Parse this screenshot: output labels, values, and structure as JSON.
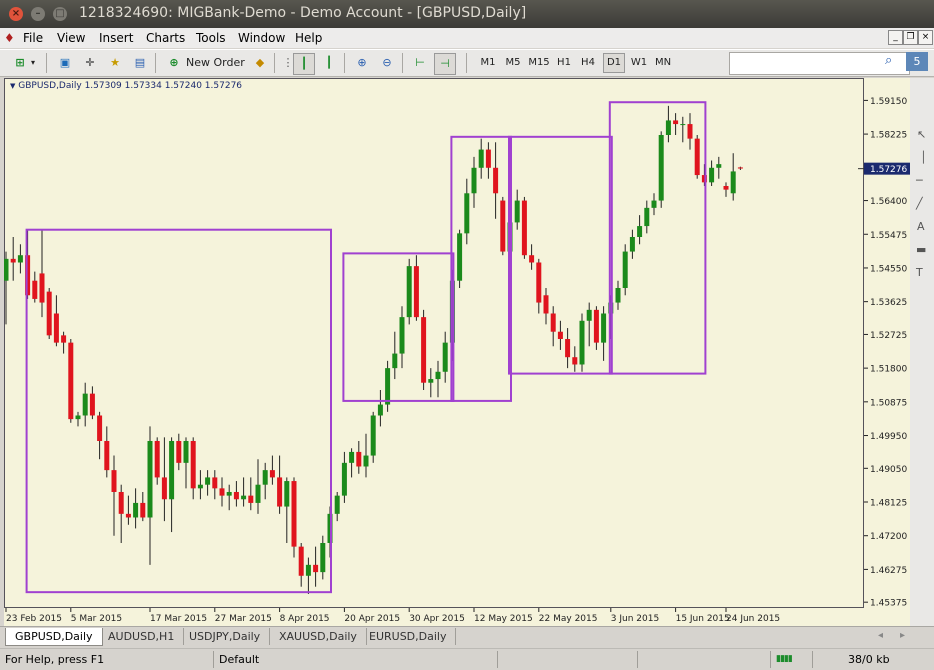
{
  "window": {
    "title": "1218324690: MIGBank-Demo - Demo Account - [GBPUSD,Daily]"
  },
  "menu": [
    "File",
    "View",
    "Insert",
    "Charts",
    "Tools",
    "Window",
    "Help"
  ],
  "toolbar": {
    "new_order_label": "New Order",
    "timeframes": [
      "M1",
      "M5",
      "M15",
      "H1",
      "H4",
      "D1",
      "W1",
      "MN"
    ],
    "active_timeframe": "D1",
    "search_value": "",
    "badge_count": "5"
  },
  "chart": {
    "header": "GBPUSD,Daily  1.57309 1.57334 1.57240 1.57276",
    "current_price": "1.57276",
    "price_ticks": [
      "1.59150",
      "1.58225",
      "1.57276",
      "1.56400",
      "1.55475",
      "1.54550",
      "1.53625",
      "1.52725",
      "1.51800",
      "1.50875",
      "1.49950",
      "1.49050",
      "1.48125",
      "1.47200",
      "1.46275",
      "1.45375"
    ],
    "date_ticks": [
      "23 Feb 2015",
      "5 Mar 2015",
      "17 Mar 2015",
      "27 Mar 2015",
      "8 Apr 2015",
      "20 Apr 2015",
      "30 Apr 2015",
      "12 May 2015",
      "22 May 2015",
      "3 Jun 2015",
      "15 Jun 2015",
      "24 Jun 2015"
    ],
    "colors": {
      "bull": "#1b8a1b",
      "bear": "#e0141e",
      "box": "#a040d0",
      "background": "#f5f3db"
    }
  },
  "chart_data": {
    "type": "candlestick",
    "symbol": "GBPUSD",
    "timeframe": "Daily",
    "ylim": [
      1.4538,
      1.596
    ],
    "candles": [
      {
        "o": 1.542,
        "h": 1.55,
        "l": 1.53,
        "c": 1.548
      },
      {
        "o": 1.548,
        "h": 1.554,
        "l": 1.542,
        "c": 1.547
      },
      {
        "o": 1.547,
        "h": 1.552,
        "l": 1.544,
        "c": 1.549
      },
      {
        "o": 1.549,
        "h": 1.556,
        "l": 1.537,
        "c": 1.538
      },
      {
        "o": 1.542,
        "h": 1.5445,
        "l": 1.536,
        "c": 1.537
      },
      {
        "o": 1.544,
        "h": 1.556,
        "l": 1.532,
        "c": 1.536
      },
      {
        "o": 1.539,
        "h": 1.54,
        "l": 1.526,
        "c": 1.527
      },
      {
        "o": 1.533,
        "h": 1.538,
        "l": 1.524,
        "c": 1.525
      },
      {
        "o": 1.527,
        "h": 1.528,
        "l": 1.522,
        "c": 1.525
      },
      {
        "o": 1.525,
        "h": 1.526,
        "l": 1.503,
        "c": 1.504
      },
      {
        "o": 1.504,
        "h": 1.506,
        "l": 1.502,
        "c": 1.505
      },
      {
        "o": 1.505,
        "h": 1.514,
        "l": 1.502,
        "c": 1.511
      },
      {
        "o": 1.511,
        "h": 1.513,
        "l": 1.504,
        "c": 1.505
      },
      {
        "o": 1.505,
        "h": 1.506,
        "l": 1.493,
        "c": 1.498
      },
      {
        "o": 1.498,
        "h": 1.502,
        "l": 1.488,
        "c": 1.49
      },
      {
        "o": 1.49,
        "h": 1.494,
        "l": 1.472,
        "c": 1.484
      },
      {
        "o": 1.484,
        "h": 1.486,
        "l": 1.47,
        "c": 1.478
      },
      {
        "o": 1.478,
        "h": 1.483,
        "l": 1.475,
        "c": 1.477
      },
      {
        "o": 1.477,
        "h": 1.485,
        "l": 1.474,
        "c": 1.481
      },
      {
        "o": 1.481,
        "h": 1.484,
        "l": 1.476,
        "c": 1.477
      },
      {
        "o": 1.477,
        "h": 1.502,
        "l": 1.464,
        "c": 1.498
      },
      {
        "o": 1.498,
        "h": 1.499,
        "l": 1.486,
        "c": 1.488
      },
      {
        "o": 1.488,
        "h": 1.499,
        "l": 1.476,
        "c": 1.482
      },
      {
        "o": 1.482,
        "h": 1.499,
        "l": 1.473,
        "c": 1.498
      },
      {
        "o": 1.498,
        "h": 1.5,
        "l": 1.49,
        "c": 1.492
      },
      {
        "o": 1.492,
        "h": 1.499,
        "l": 1.485,
        "c": 1.498
      },
      {
        "o": 1.498,
        "h": 1.499,
        "l": 1.482,
        "c": 1.485
      },
      {
        "o": 1.485,
        "h": 1.49,
        "l": 1.482,
        "c": 1.486
      },
      {
        "o": 1.486,
        "h": 1.49,
        "l": 1.483,
        "c": 1.488
      },
      {
        "o": 1.488,
        "h": 1.49,
        "l": 1.482,
        "c": 1.485
      },
      {
        "o": 1.485,
        "h": 1.488,
        "l": 1.48,
        "c": 1.483
      },
      {
        "o": 1.483,
        "h": 1.486,
        "l": 1.479,
        "c": 1.484
      },
      {
        "o": 1.484,
        "h": 1.487,
        "l": 1.48,
        "c": 1.482
      },
      {
        "o": 1.482,
        "h": 1.488,
        "l": 1.48,
        "c": 1.483
      },
      {
        "o": 1.483,
        "h": 1.488,
        "l": 1.479,
        "c": 1.481
      },
      {
        "o": 1.481,
        "h": 1.493,
        "l": 1.478,
        "c": 1.486
      },
      {
        "o": 1.486,
        "h": 1.492,
        "l": 1.482,
        "c": 1.49
      },
      {
        "o": 1.49,
        "h": 1.494,
        "l": 1.486,
        "c": 1.488
      },
      {
        "o": 1.488,
        "h": 1.494,
        "l": 1.478,
        "c": 1.48
      },
      {
        "o": 1.48,
        "h": 1.488,
        "l": 1.47,
        "c": 1.487
      },
      {
        "o": 1.487,
        "h": 1.488,
        "l": 1.466,
        "c": 1.469
      },
      {
        "o": 1.469,
        "h": 1.47,
        "l": 1.458,
        "c": 1.461
      },
      {
        "o": 1.461,
        "h": 1.466,
        "l": 1.456,
        "c": 1.464
      },
      {
        "o": 1.464,
        "h": 1.469,
        "l": 1.458,
        "c": 1.462
      },
      {
        "o": 1.462,
        "h": 1.472,
        "l": 1.46,
        "c": 1.47
      },
      {
        "o": 1.47,
        "h": 1.48,
        "l": 1.466,
        "c": 1.478
      },
      {
        "o": 1.478,
        "h": 1.484,
        "l": 1.476,
        "c": 1.483
      },
      {
        "o": 1.483,
        "h": 1.495,
        "l": 1.481,
        "c": 1.492
      },
      {
        "o": 1.492,
        "h": 1.496,
        "l": 1.488,
        "c": 1.495
      },
      {
        "o": 1.495,
        "h": 1.498,
        "l": 1.489,
        "c": 1.491
      },
      {
        "o": 1.491,
        "h": 1.5,
        "l": 1.488,
        "c": 1.494
      },
      {
        "o": 1.494,
        "h": 1.506,
        "l": 1.492,
        "c": 1.505
      },
      {
        "o": 1.505,
        "h": 1.512,
        "l": 1.502,
        "c": 1.508
      },
      {
        "o": 1.508,
        "h": 1.52,
        "l": 1.506,
        "c": 1.518
      },
      {
        "o": 1.518,
        "h": 1.528,
        "l": 1.515,
        "c": 1.522
      },
      {
        "o": 1.522,
        "h": 1.535,
        "l": 1.518,
        "c": 1.532
      },
      {
        "o": 1.532,
        "h": 1.548,
        "l": 1.53,
        "c": 1.546
      },
      {
        "o": 1.546,
        "h": 1.549,
        "l": 1.531,
        "c": 1.532
      },
      {
        "o": 1.532,
        "h": 1.534,
        "l": 1.512,
        "c": 1.514
      },
      {
        "o": 1.514,
        "h": 1.518,
        "l": 1.51,
        "c": 1.515
      },
      {
        "o": 1.515,
        "h": 1.52,
        "l": 1.51,
        "c": 1.517
      },
      {
        "o": 1.517,
        "h": 1.528,
        "l": 1.514,
        "c": 1.525
      },
      {
        "o": 1.525,
        "h": 1.545,
        "l": 1.52,
        "c": 1.542
      },
      {
        "o": 1.542,
        "h": 1.556,
        "l": 1.54,
        "c": 1.555
      },
      {
        "o": 1.555,
        "h": 1.57,
        "l": 1.552,
        "c": 1.566
      },
      {
        "o": 1.566,
        "h": 1.576,
        "l": 1.562,
        "c": 1.573
      },
      {
        "o": 1.573,
        "h": 1.581,
        "l": 1.57,
        "c": 1.578
      },
      {
        "o": 1.578,
        "h": 1.58,
        "l": 1.57,
        "c": 1.573
      },
      {
        "o": 1.573,
        "h": 1.58,
        "l": 1.559,
        "c": 1.566
      },
      {
        "o": 1.564,
        "h": 1.565,
        "l": 1.549,
        "c": 1.55
      },
      {
        "o": 1.55,
        "h": 1.561,
        "l": 1.544,
        "c": 1.558
      },
      {
        "o": 1.558,
        "h": 1.567,
        "l": 1.556,
        "c": 1.564
      },
      {
        "o": 1.564,
        "h": 1.565,
        "l": 1.548,
        "c": 1.549
      },
      {
        "o": 1.549,
        "h": 1.552,
        "l": 1.545,
        "c": 1.547
      },
      {
        "o": 1.547,
        "h": 1.548,
        "l": 1.533,
        "c": 1.536
      },
      {
        "o": 1.538,
        "h": 1.54,
        "l": 1.53,
        "c": 1.533
      },
      {
        "o": 1.533,
        "h": 1.535,
        "l": 1.524,
        "c": 1.528
      },
      {
        "o": 1.528,
        "h": 1.531,
        "l": 1.523,
        "c": 1.526
      },
      {
        "o": 1.526,
        "h": 1.529,
        "l": 1.518,
        "c": 1.521
      },
      {
        "o": 1.521,
        "h": 1.524,
        "l": 1.517,
        "c": 1.519
      },
      {
        "o": 1.519,
        "h": 1.533,
        "l": 1.517,
        "c": 1.531
      },
      {
        "o": 1.531,
        "h": 1.536,
        "l": 1.524,
        "c": 1.534
      },
      {
        "o": 1.534,
        "h": 1.535,
        "l": 1.523,
        "c": 1.525
      },
      {
        "o": 1.525,
        "h": 1.535,
        "l": 1.52,
        "c": 1.533
      },
      {
        "o": 1.533,
        "h": 1.538,
        "l": 1.526,
        "c": 1.536
      },
      {
        "o": 1.536,
        "h": 1.542,
        "l": 1.534,
        "c": 1.54
      },
      {
        "o": 1.54,
        "h": 1.552,
        "l": 1.538,
        "c": 1.55
      },
      {
        "o": 1.55,
        "h": 1.556,
        "l": 1.548,
        "c": 1.554
      },
      {
        "o": 1.554,
        "h": 1.56,
        "l": 1.552,
        "c": 1.557
      },
      {
        "o": 1.557,
        "h": 1.564,
        "l": 1.555,
        "c": 1.562
      },
      {
        "o": 1.562,
        "h": 1.566,
        "l": 1.56,
        "c": 1.564
      },
      {
        "o": 1.564,
        "h": 1.583,
        "l": 1.562,
        "c": 1.582
      },
      {
        "o": 1.582,
        "h": 1.59,
        "l": 1.58,
        "c": 1.586
      },
      {
        "o": 1.586,
        "h": 1.588,
        "l": 1.582,
        "c": 1.585
      },
      {
        "o": 1.585,
        "h": 1.587,
        "l": 1.58,
        "c": 1.585
      },
      {
        "o": 1.585,
        "h": 1.588,
        "l": 1.578,
        "c": 1.581
      },
      {
        "o": 1.581,
        "h": 1.582,
        "l": 1.57,
        "c": 1.571
      },
      {
        "o": 1.571,
        "h": 1.574,
        "l": 1.568,
        "c": 1.569
      },
      {
        "o": 1.569,
        "h": 1.575,
        "l": 1.568,
        "c": 1.573
      },
      {
        "o": 1.573,
        "h": 1.576,
        "l": 1.57,
        "c": 1.574
      },
      {
        "o": 1.568,
        "h": 1.569,
        "l": 1.565,
        "c": 1.567
      },
      {
        "o": 1.566,
        "h": 1.577,
        "l": 1.564,
        "c": 1.572
      },
      {
        "o": 1.5731,
        "h": 1.5733,
        "l": 1.5724,
        "c": 1.5728
      }
    ],
    "highlight_boxes": [
      {
        "from": 3,
        "to": 45,
        "high": 1.556,
        "low": 1.4565
      },
      {
        "from": 47,
        "to": 62,
        "high": 1.5495,
        "low": 1.509
      },
      {
        "from": 62,
        "to": 70,
        "high": 1.5815,
        "low": 1.509
      },
      {
        "from": 70,
        "to": 84,
        "high": 1.5815,
        "low": 1.5165
      },
      {
        "from": 84,
        "to": 97,
        "high": 1.591,
        "low": 1.5165
      }
    ]
  },
  "tabs": [
    "GBPUSD,Daily",
    "AUDUSD,H1",
    "USDJPY,Daily",
    "XAUUSD,Daily",
    "EURUSD,Daily"
  ],
  "active_tab": "GBPUSD,Daily",
  "status": {
    "help": "For Help, press F1",
    "profile": "Default",
    "traffic": "38/0 kb"
  }
}
